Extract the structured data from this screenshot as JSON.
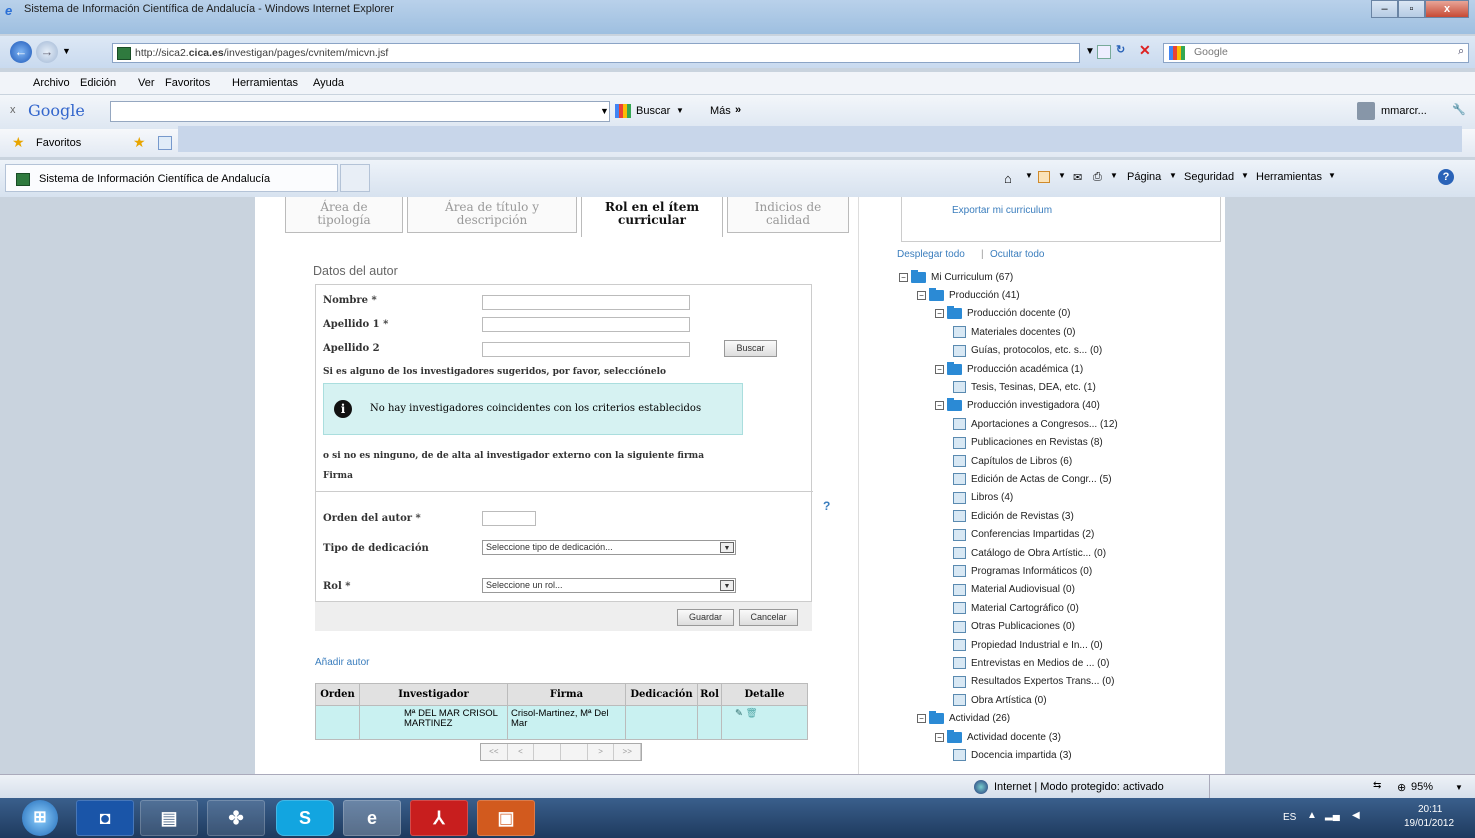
{
  "window": {
    "title": "Sistema de Información Científica de Andalucía - Windows Internet Explorer"
  },
  "address": {
    "url_prefix": "http://sica2.",
    "url_bold": "cica.es",
    "url_rest": "/investigan/pages/cvnitem/micvn.jsf",
    "search_engine": "Google"
  },
  "menu": [
    "Archivo",
    "Edición",
    "Ver",
    "Favoritos",
    "Herramientas",
    "Ayuda"
  ],
  "google_bar": {
    "close": "x",
    "logo": "Google",
    "search_label": "Buscar",
    "more_label": "Más",
    "user": "mmarcr..."
  },
  "favorites": {
    "label": "Favoritos"
  },
  "tab": {
    "title": "Sistema de Información Científica de Andalucía"
  },
  "commandbar": {
    "page": "Página",
    "security": "Seguridad",
    "tools": "Herramientas"
  },
  "form_tabs": [
    {
      "line1": "Área de",
      "line2": "tipología"
    },
    {
      "line1": "Área de título y",
      "line2": "descripción"
    },
    {
      "line1": "Rol en el ítem",
      "line2": "curricular"
    },
    {
      "line1": "Indicios de",
      "line2": "calidad"
    }
  ],
  "section_title": "Datos del autor",
  "form": {
    "nombre_label": "Nombre *",
    "apellido1_label": "Apellido 1 *",
    "apellido2_label": "Apellido 2",
    "buscar_button": "Buscar",
    "suggest_text": "Si es alguno de los investigadores sugeridos, por favor, selecciónelo",
    "info_message": "No hay investigadores coincidentes con los criterios establecidos",
    "external_text": "o si no es ninguno, de de alta al investigador externo con la siguiente firma",
    "firma_label": "Firma",
    "orden_label": "Orden del autor *",
    "dedicacion_label": "Tipo de dedicación",
    "dedicacion_value": "Seleccione tipo de dedicación...",
    "rol_label": "Rol *",
    "rol_value": "Seleccione un rol...",
    "guardar_button": "Guardar",
    "cancelar_button": "Cancelar",
    "help": "?"
  },
  "add_author_link": "Añadir autor",
  "table": {
    "headers": [
      "Orden",
      "Investigador",
      "Firma",
      "Dedicación",
      "Rol",
      "Detalle"
    ],
    "row": {
      "investigador": "Mª DEL MAR CRISOL MARTINEZ",
      "firma": "Crisol-Martinez, Mª Del Mar"
    }
  },
  "pager": [
    "<<",
    "<",
    "",
    "",
    ">",
    ">>"
  ],
  "right": {
    "export_link": "Exportar mi curriculum",
    "expand_all": "Desplegar todo",
    "separator": "|",
    "collapse_all": "Ocultar todo"
  },
  "tree": [
    {
      "label": "Mi Curriculum (67)",
      "type": "folder",
      "level": 0
    },
    {
      "label": "Producción (41)",
      "type": "folder",
      "level": 1
    },
    {
      "label": "Producción docente (0)",
      "type": "folder",
      "level": 2
    },
    {
      "label": "Materiales docentes (0)",
      "type": "doc",
      "level": 3
    },
    {
      "label": "Guías, protocolos, etc. s... (0)",
      "type": "doc",
      "level": 3
    },
    {
      "label": "Producción académica (1)",
      "type": "folder",
      "level": 2
    },
    {
      "label": "Tesis, Tesinas, DEA, etc. (1)",
      "type": "doc",
      "level": 3
    },
    {
      "label": "Producción investigadora (40)",
      "type": "folder",
      "level": 2
    },
    {
      "label": "Aportaciones a Congresos... (12)",
      "type": "doc",
      "level": 3
    },
    {
      "label": "Publicaciones en Revistas (8)",
      "type": "doc",
      "level": 3
    },
    {
      "label": "Capítulos de Libros (6)",
      "type": "doc",
      "level": 3
    },
    {
      "label": "Edición de Actas de Congr... (5)",
      "type": "doc",
      "level": 3
    },
    {
      "label": "Libros (4)",
      "type": "doc",
      "level": 3
    },
    {
      "label": "Edición de Revistas (3)",
      "type": "doc",
      "level": 3
    },
    {
      "label": "Conferencias Impartidas (2)",
      "type": "doc",
      "level": 3
    },
    {
      "label": "Catálogo de Obra Artístic... (0)",
      "type": "doc",
      "level": 3
    },
    {
      "label": "Programas Informáticos (0)",
      "type": "doc",
      "level": 3
    },
    {
      "label": "Material Audiovisual (0)",
      "type": "doc",
      "level": 3
    },
    {
      "label": "Material Cartográfico (0)",
      "type": "doc",
      "level": 3
    },
    {
      "label": "Otras Publicaciones (0)",
      "type": "doc",
      "level": 3
    },
    {
      "label": "Propiedad Industrial e In... (0)",
      "type": "doc",
      "level": 3
    },
    {
      "label": "Entrevistas en Medios de ... (0)",
      "type": "doc",
      "level": 3
    },
    {
      "label": "Resultados Expertos Trans... (0)",
      "type": "doc",
      "level": 3
    },
    {
      "label": "Obra Artística (0)",
      "type": "doc",
      "level": 3
    },
    {
      "label": "Actividad (26)",
      "type": "folder",
      "level": 1
    },
    {
      "label": "Actividad docente (3)",
      "type": "folder",
      "level": 2
    },
    {
      "label": "Docencia impartida (3)",
      "type": "doc",
      "level": 3
    }
  ],
  "status": {
    "zone": "Internet | Modo protegido: activado",
    "zoom": "95%"
  },
  "taskbar": {
    "lang": "ES",
    "time": "20:11",
    "date": "19/01/2012"
  }
}
